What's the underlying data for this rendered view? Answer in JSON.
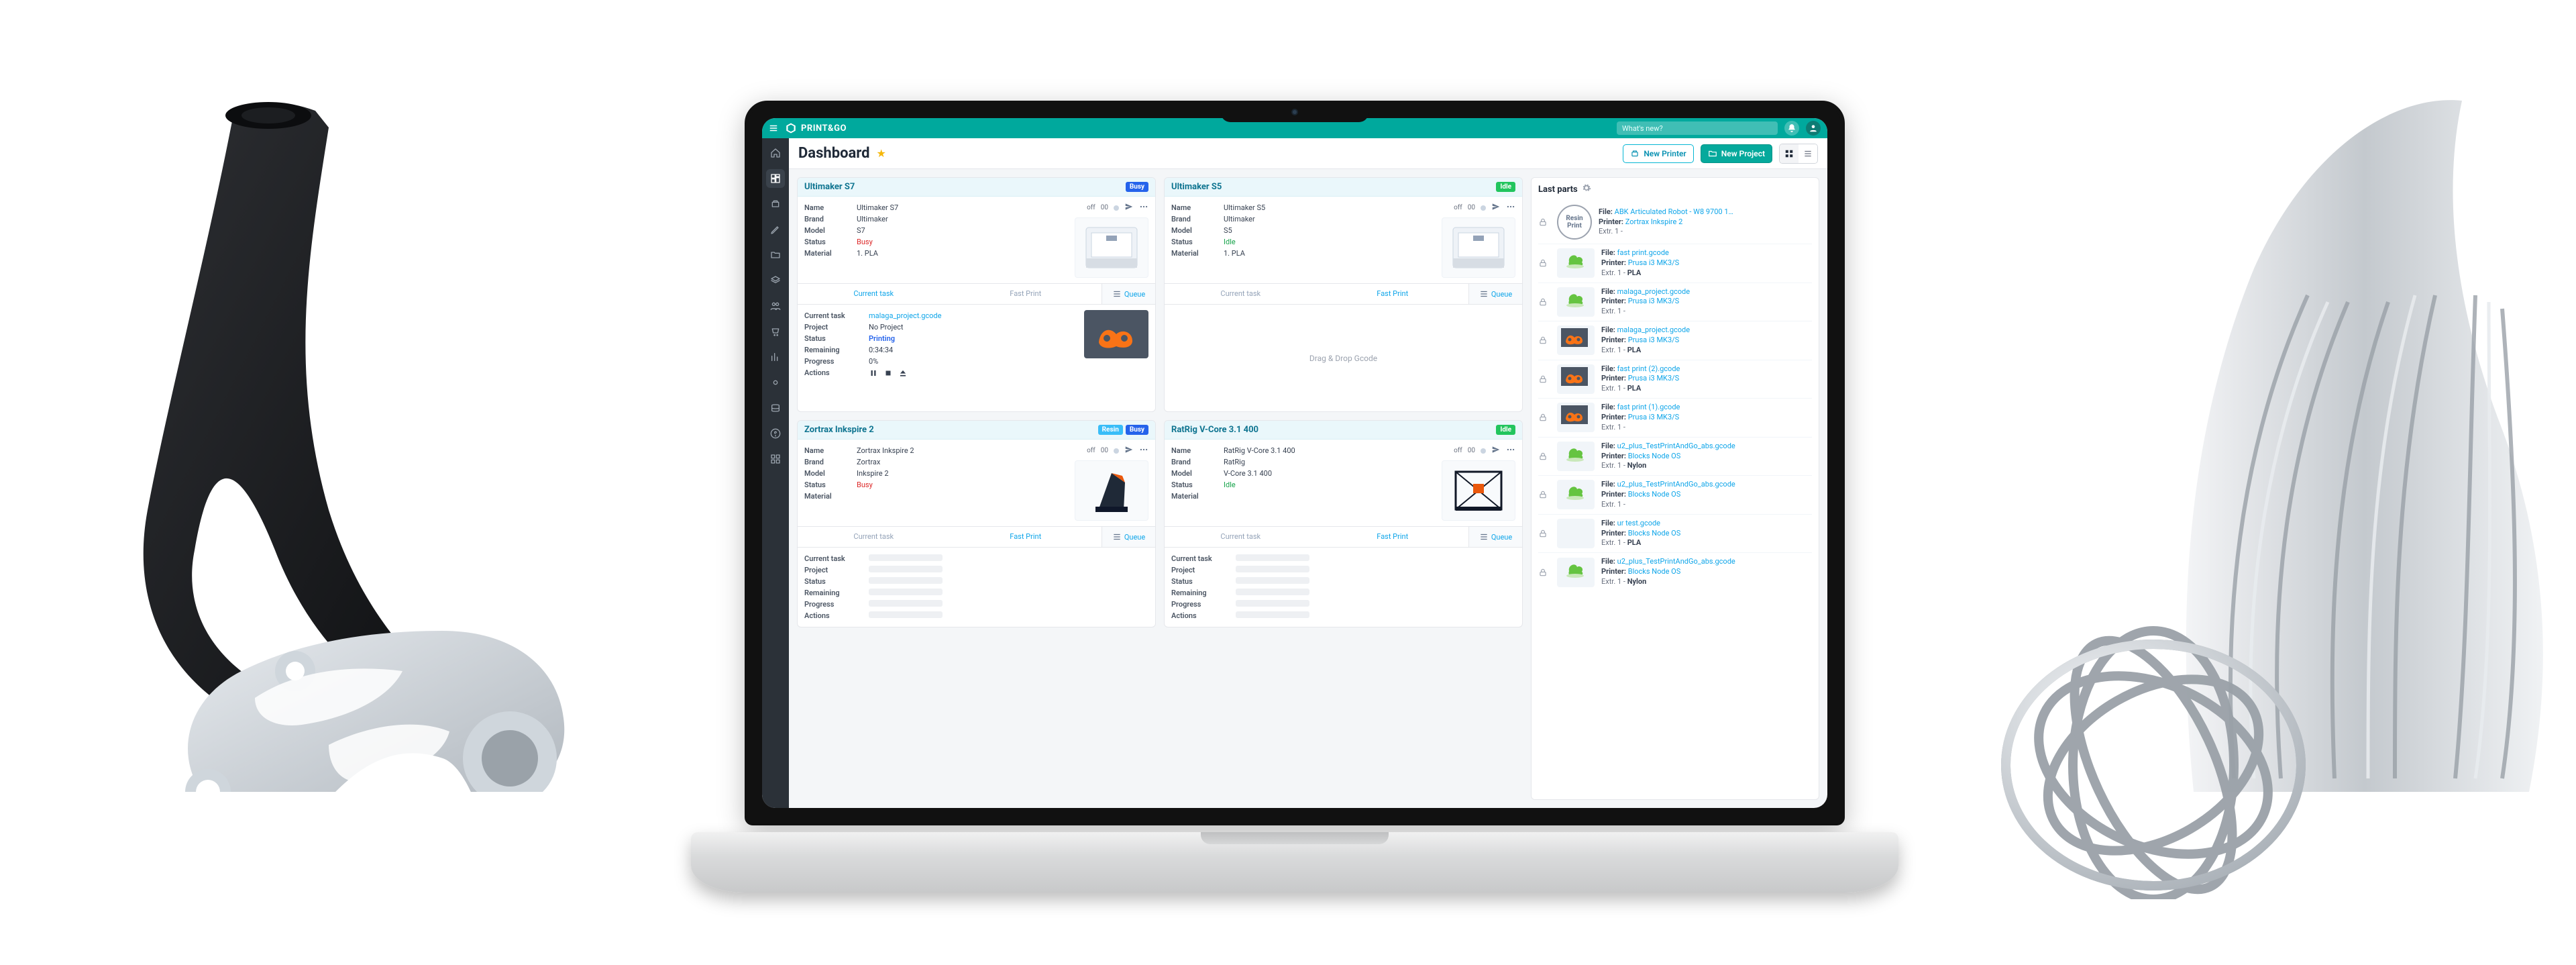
{
  "topbar": {
    "brand": "PRINT&GO",
    "search_placeholder": "What's new?"
  },
  "page": {
    "title": "Dashboard",
    "new_printer": "New Printer",
    "new_project": "New Project"
  },
  "labels": {
    "name": "Name",
    "brand": "Brand",
    "model": "Model",
    "status": "Status",
    "material": "Material",
    "current_task_tab": "Current task",
    "fast_print_tab": "Fast Print",
    "queue": "Queue",
    "current_task": "Current task",
    "project": "Project",
    "remaining": "Remaining",
    "progress": "Progress",
    "actions": "Actions",
    "dropzone": "Drag & Drop Gcode",
    "resin_print": "Resin Print",
    "file_prefix": "File:",
    "printer_prefix": "Printer:",
    "extruder_prefix": "Extr. 1 -"
  },
  "printers": [
    {
      "id": "ultimaker-s7",
      "title": "Ultimaker S7",
      "badges": [
        "Busy"
      ],
      "name": "Ultimaker S7",
      "brand": "Ultimaker",
      "model": "S7",
      "status": "Busy",
      "status_class": "busy",
      "material": "1. PLA",
      "ext_label": "off",
      "ext_value": "00",
      "thumb": "printer-sq",
      "task": {
        "file": "malaga_project.gcode",
        "project": "No Project",
        "status": "Printing",
        "remaining": "0:34:34",
        "progress": "0%",
        "thumb": "orange-part"
      }
    },
    {
      "id": "ultimaker-s5",
      "title": "Ultimaker S5",
      "badges": [
        "Idle"
      ],
      "name": "Ultimaker S5",
      "brand": "Ultimaker",
      "model": "S5",
      "status": "Idle",
      "status_class": "idle",
      "material": "1. PLA",
      "ext_label": "off",
      "ext_value": "00",
      "thumb": "printer-sq",
      "dropzone": true
    },
    {
      "id": "zortrax-inkspire-2",
      "title": "Zortrax Inkspire 2",
      "badges": [
        "Resin",
        "Busy"
      ],
      "name": "Zortrax Inkspire 2",
      "brand": "Zortrax",
      "model": "Inkspire 2",
      "status": "Busy",
      "status_class": "busy",
      "material": "",
      "ext_label": "off",
      "ext_value": "00",
      "thumb": "printer-resin",
      "task": {
        "skeleton": true
      }
    },
    {
      "id": "ratrig-vcore-31-400",
      "title": "RatRig V-Core 3.1 400",
      "badges": [
        "Idle"
      ],
      "name": "RatRig V-Core 3.1 400",
      "brand": "RatRig",
      "model": "V-Core 3.1 400",
      "status": "Idle",
      "status_class": "idle",
      "material": "",
      "ext_label": "off",
      "ext_value": "00",
      "thumb": "printer-frame",
      "task": {
        "skeleton": true
      }
    }
  ],
  "last_parts_title": "Last parts",
  "last_parts": [
    {
      "thumb": "resin-circle",
      "file": "ABK Articulated Robot - W8 9700 1…",
      "printer": "Zortrax Inkspire 2",
      "extr": ""
    },
    {
      "thumb": "green-blob",
      "file": "fast print.gcode",
      "printer": "Prusa i3 MK3/S",
      "extr": "PLA"
    },
    {
      "thumb": "green-blob",
      "file": "malaga_project.gcode",
      "printer": "Prusa i3 MK3/S",
      "extr": ""
    },
    {
      "thumb": "orange-part",
      "file": "malaga_project.gcode",
      "printer": "Prusa i3 MK3/S",
      "extr": "PLA"
    },
    {
      "thumb": "orange-part",
      "file": "fast print (2).gcode",
      "printer": "Prusa i3 MK3/S",
      "extr": "PLA"
    },
    {
      "thumb": "orange-part",
      "file": "fast print (1).gcode",
      "printer": "Prusa i3 MK3/S",
      "extr": ""
    },
    {
      "thumb": "green-blob",
      "file": "u2_plus_TestPrintAndGo_abs.gcode",
      "printer": "Blocks Node OS",
      "extr": "Nylon"
    },
    {
      "thumb": "green-blob",
      "file": "u2_plus_TestPrintAndGo_abs.gcode",
      "printer": "Blocks Node OS",
      "extr": ""
    },
    {
      "thumb": "blank",
      "file": "ur test.gcode",
      "printer": "Blocks Node OS",
      "extr": "PLA"
    },
    {
      "thumb": "green-blob",
      "file": "u2_plus_TestPrintAndGo_abs.gcode",
      "printer": "Blocks Node OS",
      "extr": "Nylon"
    }
  ],
  "sidenav": [
    "home",
    "dashboard",
    "printers",
    "pen",
    "folder",
    "layers",
    "users",
    "cart",
    "chart",
    "settings",
    "database",
    "help",
    "grid"
  ]
}
